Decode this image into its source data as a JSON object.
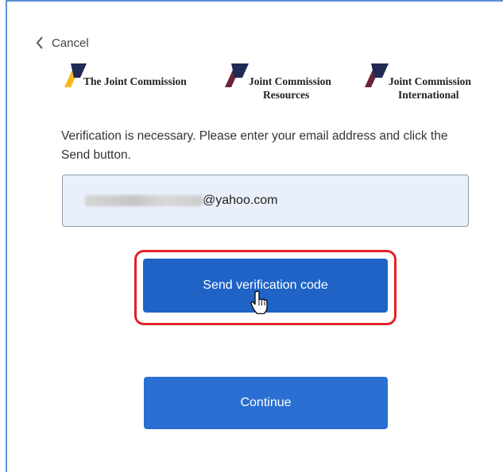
{
  "cancel": {
    "label": "Cancel",
    "icon": "chevron-left-icon"
  },
  "logos": [
    {
      "line1": "The Joint Commission",
      "line2": ""
    },
    {
      "line1": "Joint Commission",
      "line2": "Resources"
    },
    {
      "line1": "Joint Commission",
      "line2": "International"
    }
  ],
  "instructions": "Verification is necessary. Please enter your email address and click the Send button.",
  "email": {
    "visible_value": "@yahoo.com"
  },
  "buttons": {
    "send_verification": "Send verification code",
    "continue": "Continue"
  },
  "colors": {
    "primary_button": "#1f63c6",
    "highlight_outline": "#e3202b",
    "input_background": "#e9f0fb",
    "logo_gold": "#f5b81c",
    "logo_navy": "#1f2a56",
    "logo_maroon": "#6d2338"
  }
}
